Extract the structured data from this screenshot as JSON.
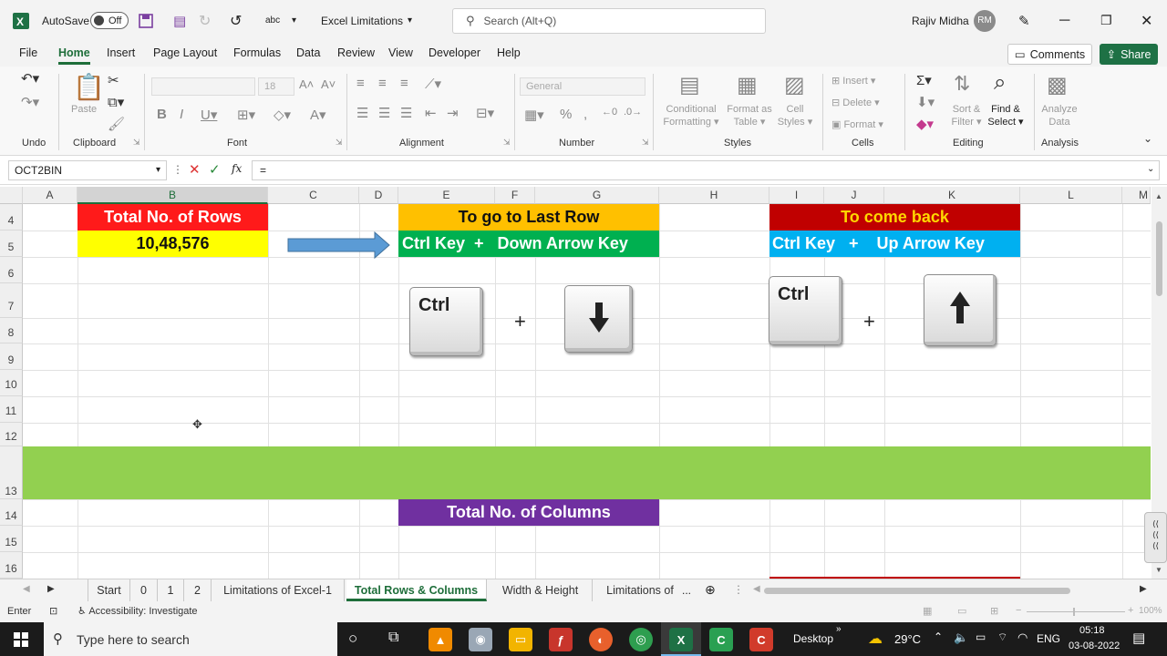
{
  "titlebar": {
    "autosave_label": "AutoSave",
    "autosave_state": "Off",
    "doc_title": "Excel Limitations",
    "search_placeholder": "Search (Alt+Q)",
    "user_name": "Rajiv Midha",
    "user_initials": "RM"
  },
  "menu": {
    "tabs": [
      "File",
      "Home",
      "Insert",
      "Page Layout",
      "Formulas",
      "Data",
      "Review",
      "View",
      "Developer",
      "Help"
    ],
    "active": "Home",
    "comments_label": "Comments",
    "share_label": "Share"
  },
  "ribbon": {
    "groups": [
      "Undo",
      "Clipboard",
      "Font",
      "Alignment",
      "Number",
      "Styles",
      "Cells",
      "Editing",
      "Analysis"
    ],
    "paste_label": "Paste",
    "font_size": "18",
    "number_format": "General",
    "conditional_formatting": [
      "Conditional",
      "Formatting"
    ],
    "format_as_table": [
      "Format as",
      "Table"
    ],
    "cell_styles": [
      "Cell",
      "Styles"
    ],
    "insert_label": "Insert",
    "delete_label": "Delete",
    "format_label": "Format",
    "sort_filter": [
      "Sort &",
      "Filter"
    ],
    "find_select": [
      "Find &",
      "Select"
    ],
    "analyze_data": [
      "Analyze",
      "Data"
    ]
  },
  "formula_bar": {
    "name_box": "OCT2BIN",
    "fx_symbol": "fx",
    "content": "="
  },
  "grid": {
    "columns": [
      "A",
      "B",
      "C",
      "D",
      "E",
      "F",
      "G",
      "H",
      "I",
      "J",
      "K",
      "L",
      "M"
    ],
    "selected_column": "B",
    "rows": [
      "4",
      "5",
      "6",
      "7",
      "8",
      "9",
      "10",
      "11",
      "12",
      "13",
      "14",
      "15",
      "16"
    ],
    "total_rows_header": "Total No. of Rows",
    "total_rows_value": "10,48,576",
    "last_row_header": "To go to Last Row",
    "last_row_shortcut": "Ctrl Key  +   Down Arrow Key",
    "come_back_header": "To come back",
    "come_back_shortcut": "Ctrl Key   +    Up Arrow Key",
    "total_columns_header": "Total No. of Columns",
    "key_ctrl": "Ctrl",
    "plus": "+",
    "colors": {
      "red": "#ff1a1a",
      "yellow": "#ffff00",
      "orange": "#ffc000",
      "green": "#00b050",
      "dark_red": "#c00000",
      "cyan": "#00b0f0",
      "lime_band": "#92d050",
      "purple": "#7030a0",
      "arrow_blue": "#5b9bd5"
    }
  },
  "sheets": {
    "tabs": [
      "Start",
      "0",
      "1",
      "2",
      "Limitations of Excel-1",
      "Total Rows & Columns",
      "Width & Height",
      "Limitations of"
    ],
    "active": "Total Rows & Columns",
    "ellipsis": "..."
  },
  "status": {
    "mode": "Enter",
    "accessibility": "Accessibility: Investigate",
    "zoom": "100%"
  },
  "taskbar": {
    "search_placeholder": "Type here to search",
    "desktop_label": "Desktop",
    "temperature": "29°C",
    "language": "ENG",
    "time": "05:18",
    "date": "03-08-2022"
  }
}
